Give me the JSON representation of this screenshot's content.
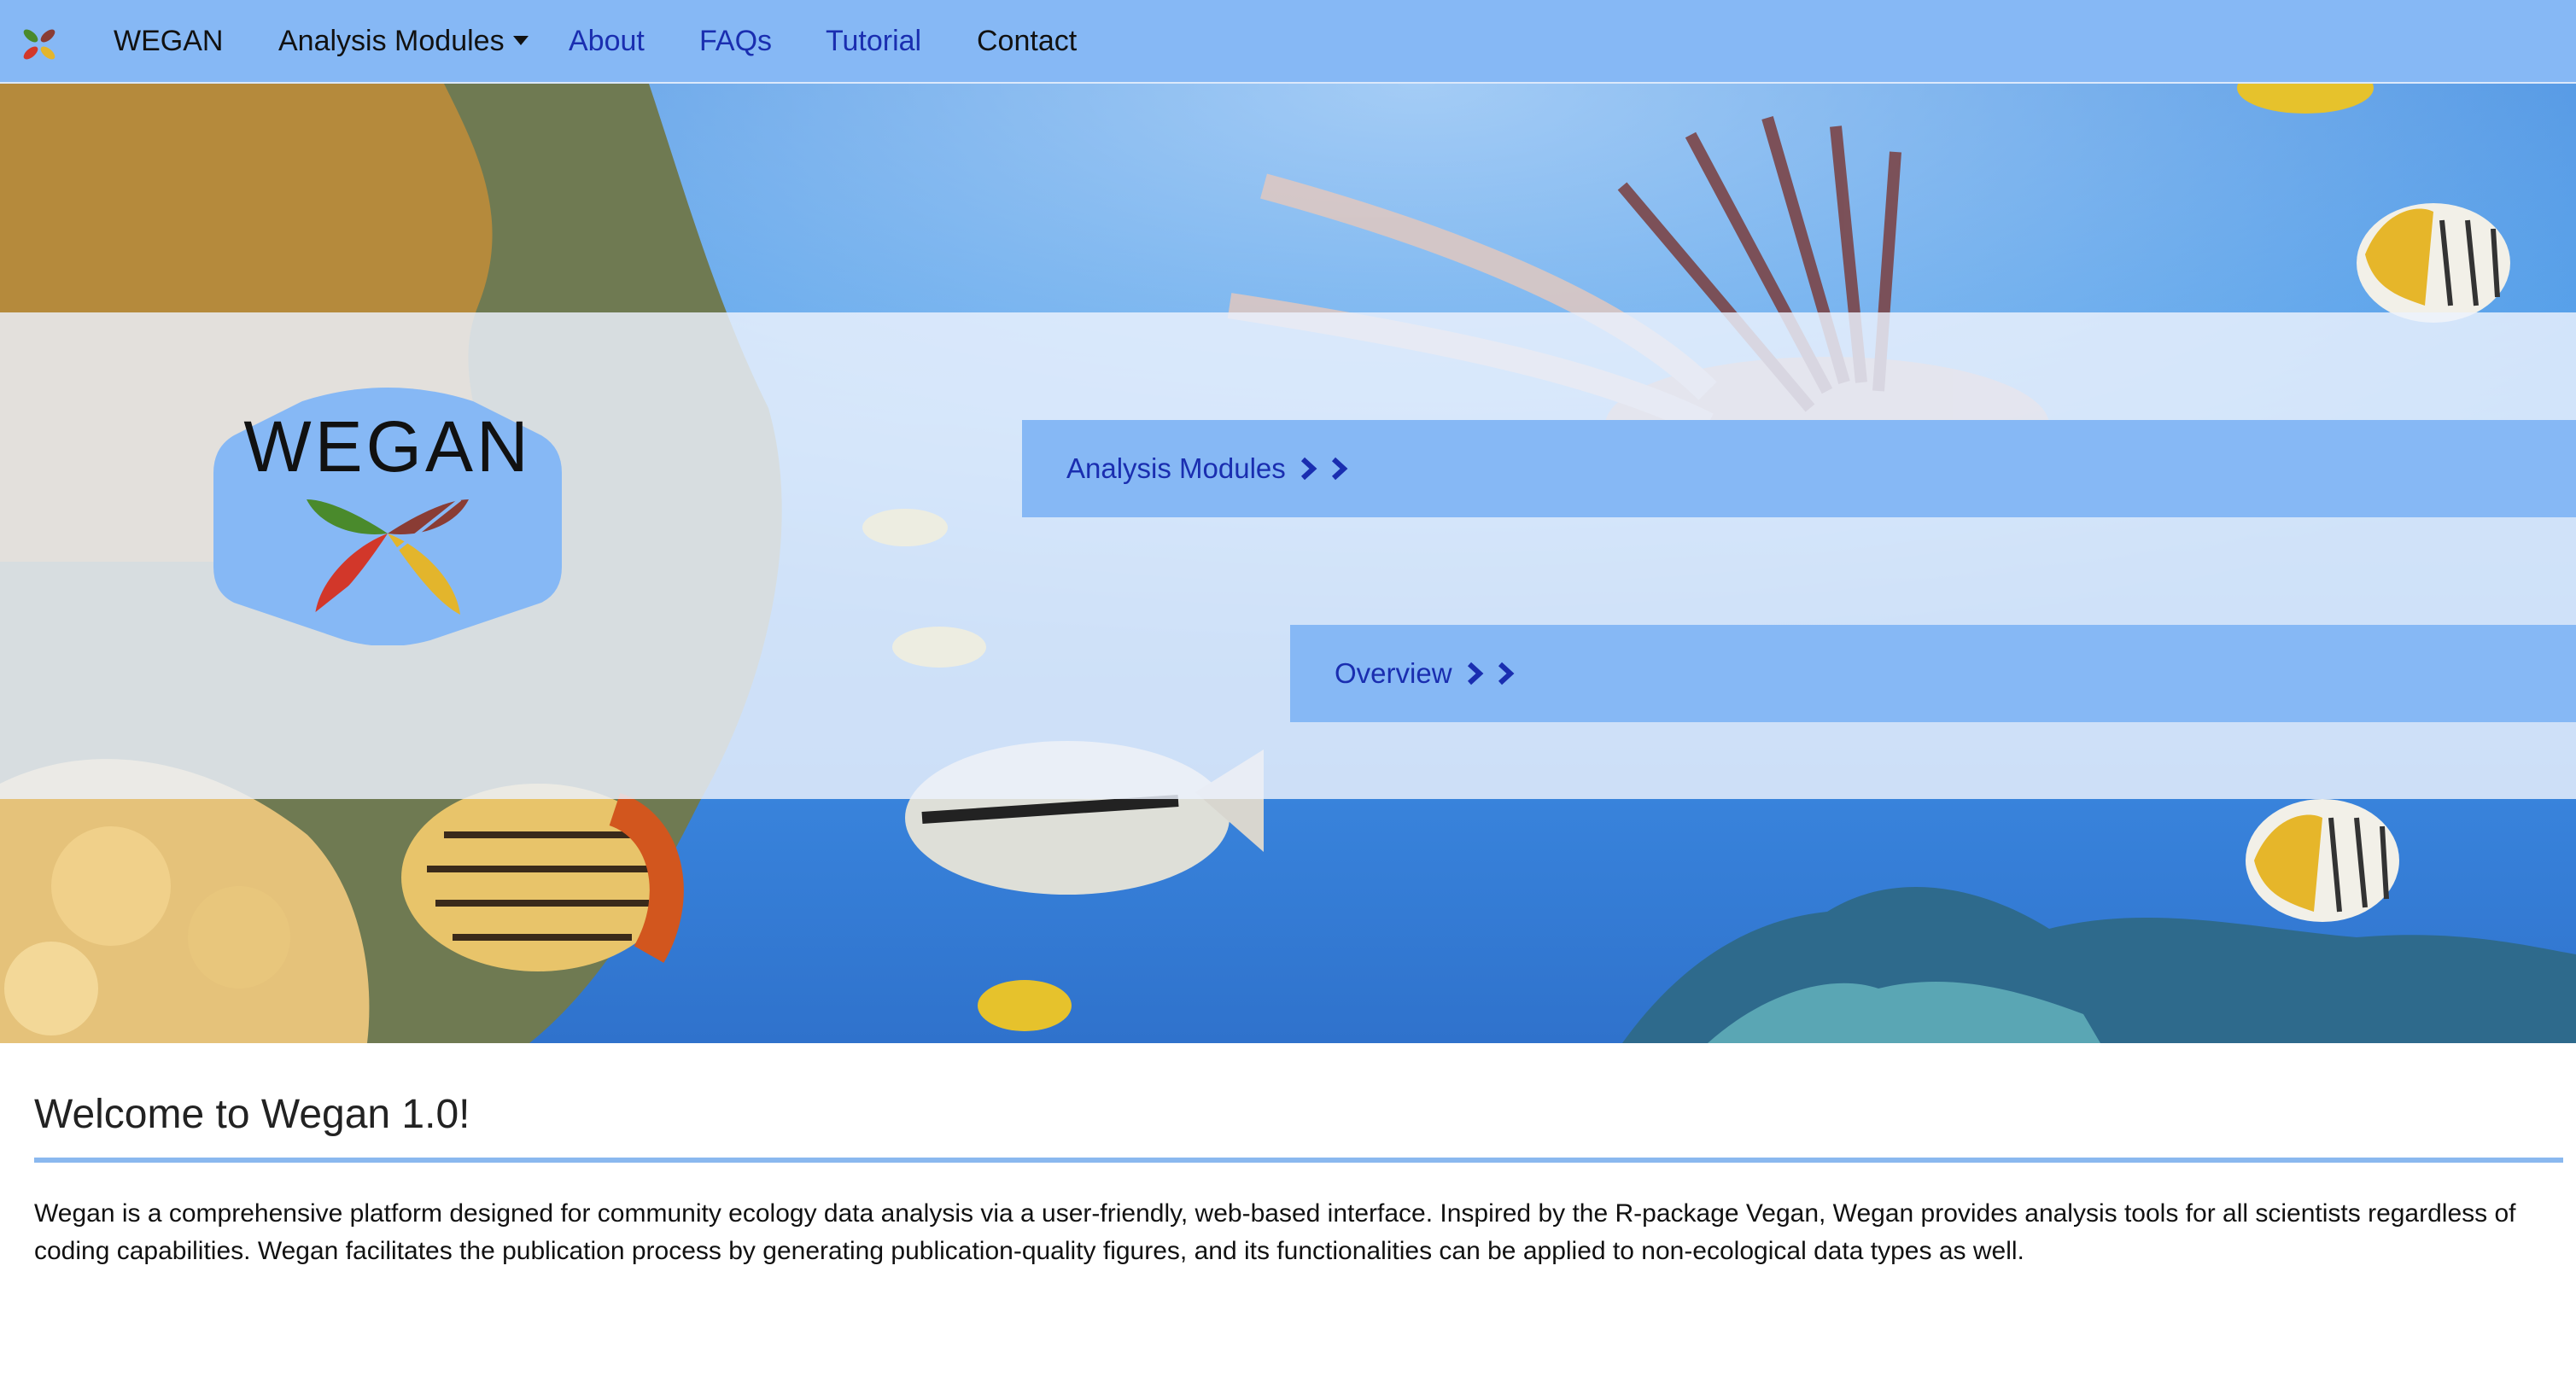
{
  "nav": {
    "brand": "WEGAN",
    "analysis_modules": "Analysis Modules",
    "about": "About",
    "faqs": "FAQs",
    "tutorial": "Tutorial",
    "contact": "Contact"
  },
  "hero": {
    "logo_text": "WEGAN",
    "analysis_modules_button": "Analysis Modules",
    "overview_button": "Overview"
  },
  "main": {
    "heading": "Welcome to Wegan 1.0!",
    "intro": "Wegan is a comprehensive platform designed for community ecology data analysis via a user-friendly, web-based interface. Inspired by the R-package Vegan, Wegan provides analysis tools for all scientists regardless of coding capabilities. Wegan facilitates the publication process by generating publication-quality figures, and its functionalities can be applied to non-ecological data types as well."
  },
  "icons": {
    "brand": "leaf-cluster-icon",
    "caret": "caret-down-icon",
    "chevron": "chevron-right-icon"
  },
  "colors": {
    "accent": "#86b8f5",
    "link": "#1a2eb0",
    "leaf_green": "#4a8a2c",
    "leaf_brown": "#8a3c34",
    "leaf_red": "#d2372a",
    "leaf_yellow": "#e3b52c"
  }
}
